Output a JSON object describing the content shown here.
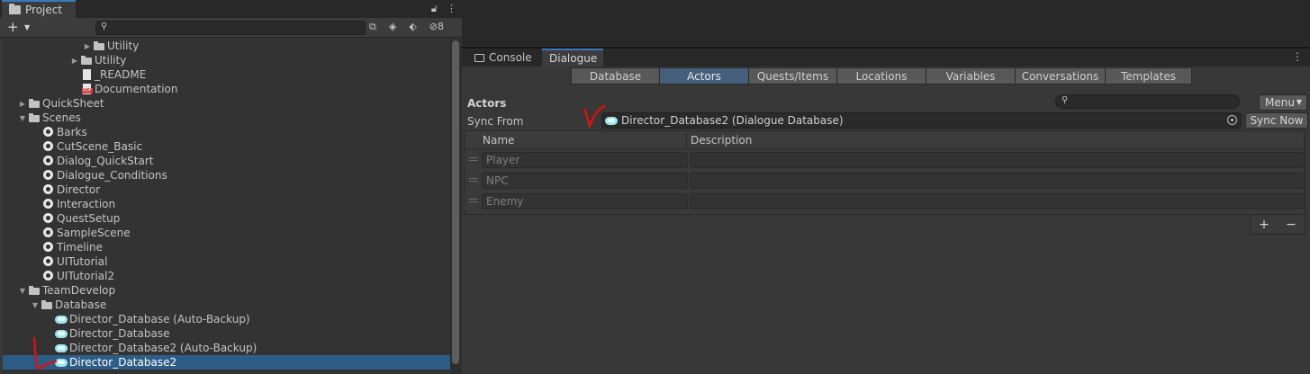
{
  "project_panel": {
    "tab_label": "Project",
    "hidden_count": "8",
    "tree": [
      {
        "label": "Utility",
        "indent": 88,
        "arrow": "▶",
        "icon": "folder"
      },
      {
        "label": "Utility",
        "indent": 74,
        "arrow": "▶",
        "icon": "folder"
      },
      {
        "label": "_README",
        "indent": 74,
        "arrow": "",
        "icon": "file"
      },
      {
        "label": "Documentation",
        "indent": 74,
        "arrow": "",
        "icon": "pdf"
      },
      {
        "label": "QuickSheet",
        "indent": 16,
        "arrow": "▶",
        "icon": "folder"
      },
      {
        "label": "Scenes",
        "indent": 16,
        "arrow": "▼",
        "icon": "folder"
      },
      {
        "label": "Barks",
        "indent": 32,
        "arrow": "",
        "icon": "scene"
      },
      {
        "label": "CutScene_Basic",
        "indent": 32,
        "arrow": "",
        "icon": "scene"
      },
      {
        "label": "Dialog_QuickStart",
        "indent": 32,
        "arrow": "",
        "icon": "scene"
      },
      {
        "label": "Dialogue_Conditions",
        "indent": 32,
        "arrow": "",
        "icon": "scene"
      },
      {
        "label": "Director",
        "indent": 32,
        "arrow": "",
        "icon": "scene"
      },
      {
        "label": "Interaction",
        "indent": 32,
        "arrow": "",
        "icon": "scene"
      },
      {
        "label": "QuestSetup",
        "indent": 32,
        "arrow": "",
        "icon": "scene"
      },
      {
        "label": "SampleScene",
        "indent": 32,
        "arrow": "",
        "icon": "scene"
      },
      {
        "label": "Timeline",
        "indent": 32,
        "arrow": "",
        "icon": "scene"
      },
      {
        "label": "UITutorial",
        "indent": 32,
        "arrow": "",
        "icon": "scene"
      },
      {
        "label": "UITutorial2",
        "indent": 32,
        "arrow": "",
        "icon": "scene"
      },
      {
        "label": "TeamDevelop",
        "indent": 16,
        "arrow": "▼",
        "icon": "folder"
      },
      {
        "label": "Database",
        "indent": 30,
        "arrow": "▼",
        "icon": "folder"
      },
      {
        "label": "Director_Database (Auto-Backup)",
        "indent": 46,
        "arrow": "",
        "icon": "db"
      },
      {
        "label": "Director_Database",
        "indent": 46,
        "arrow": "",
        "icon": "db"
      },
      {
        "label": "Director_Database2 (Auto-Backup)",
        "indent": 46,
        "arrow": "",
        "icon": "db"
      },
      {
        "label": "Director_Database2",
        "indent": 46,
        "arrow": "",
        "icon": "db",
        "selected": true
      }
    ]
  },
  "right_panel": {
    "tabs": [
      "Console",
      "Dialogue"
    ],
    "toolbar_tabs": [
      {
        "label": "Database",
        "active": false
      },
      {
        "label": "Actors",
        "active": true
      },
      {
        "label": "Quests/Items",
        "active": false
      },
      {
        "label": "Locations",
        "active": false
      },
      {
        "label": "Variables",
        "active": false
      },
      {
        "label": "Conversations",
        "active": false
      },
      {
        "label": "Templates",
        "active": false
      }
    ],
    "section_title": "Actors",
    "menu_label": "Menu",
    "sync_from_label": "Sync From",
    "sync_from_value": "Director_Database2 (Dialogue Database)",
    "sync_now_label": "Sync Now",
    "columns": {
      "name": "Name",
      "description": "Description"
    },
    "actors": [
      {
        "name": "Player",
        "description": ""
      },
      {
        "name": "NPC",
        "description": ""
      },
      {
        "name": "Enemy",
        "description": ""
      }
    ],
    "add_label": "+",
    "remove_label": "−"
  },
  "colors": {
    "selection": "#2c5d87",
    "active_tab": "#46607c",
    "annotation": "#e01010"
  }
}
